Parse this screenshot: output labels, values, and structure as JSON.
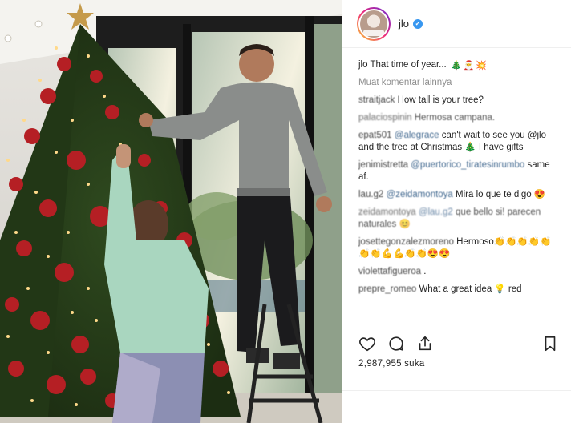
{
  "post": {
    "username": "jlo",
    "verified_mark": "✓",
    "caption_user": "jlo",
    "caption_text": "That time of year...",
    "caption_emojis": [
      "🎄",
      "🎅",
      "💥"
    ],
    "load_more_label": "Muat komentar lainnya",
    "comments": [
      {
        "user": "straitjack",
        "text": "How tall is your tree?"
      },
      {
        "user": "palaciospinin",
        "text": "Hermosa campana."
      },
      {
        "user": "epat501",
        "mention": "@alegrace",
        "text": "can't wait to see you @jlo and the tree at Christmas 🎄 I have gifts"
      },
      {
        "user": "jenimistretta",
        "mention": "@puertorico_tiratesinrumbo",
        "text": "same af."
      },
      {
        "user": "lau.g2",
        "mention": "@zeidamontoya",
        "text": "Mira lo que te digo 😍"
      },
      {
        "user": "zeidamontoya",
        "mention": "@lau.g2",
        "text": "que bello si! parecen naturales 😊"
      },
      {
        "user": "josettegonzalezmoreno",
        "text": "Hermoso👏👏👏👏👏👏👏💪💪👏👏😍😍"
      },
      {
        "user": "violettafigueroa",
        "text": "."
      },
      {
        "user": "prepre_romeo",
        "text": "What a great idea 💡 red"
      }
    ],
    "likes_count": "2,987,955",
    "likes_label": "suka"
  },
  "icons": {
    "like": "heart-icon",
    "comment": "comment-bubble-icon",
    "share": "share-icon",
    "save": "bookmark-icon"
  },
  "colors": {
    "mention": "#003569",
    "muted": "#8e8e8e",
    "verified": "#3897f0",
    "text": "#262626"
  }
}
